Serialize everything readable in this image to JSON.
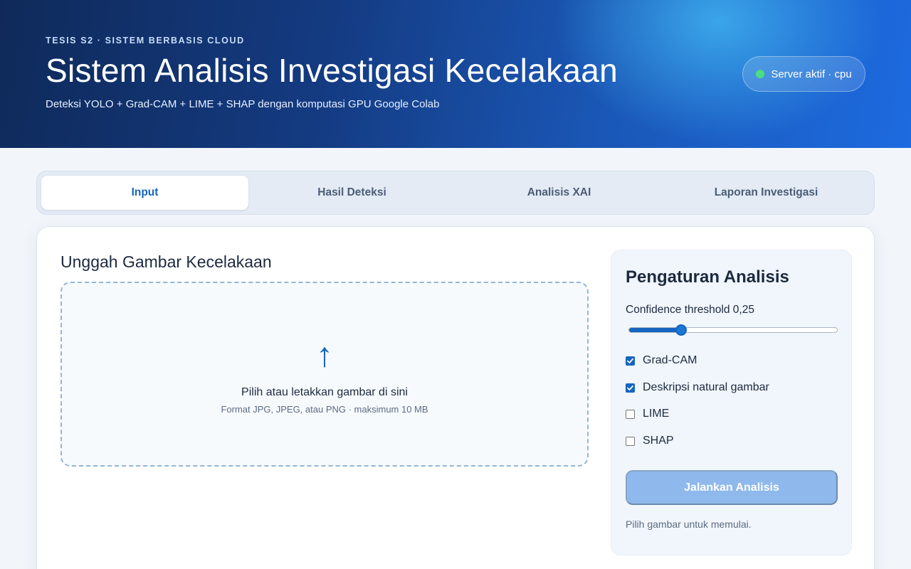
{
  "header": {
    "eyebrow": "TESIS S2 · SISTEM BERBASIS CLOUD",
    "title": "Sistem Analisis Investigasi Kecelakaan",
    "subtitle": "Deteksi YOLO + Grad-CAM + LIME + SHAP dengan komputasi GPU Google Colab",
    "server_status": "Server aktif · cpu"
  },
  "tabs": [
    {
      "label": "Input",
      "active": true
    },
    {
      "label": "Hasil Deteksi",
      "active": false
    },
    {
      "label": "Analisis XAI",
      "active": false
    },
    {
      "label": "Laporan Investigasi",
      "active": false
    }
  ],
  "upload": {
    "title": "Unggah Gambar Kecelakaan",
    "icon": "upload-arrow-icon",
    "icon_glyph": "↑",
    "main_text": "Pilih atau letakkan gambar di sini",
    "sub_text": "Format JPG, JPEG, atau PNG · maksimum 10 MB"
  },
  "settings": {
    "title": "Pengaturan Analisis",
    "threshold_label": "Confidence threshold 0,25",
    "threshold_value": 0.25,
    "options": [
      {
        "label": "Grad-CAM",
        "checked": true
      },
      {
        "label": "Deskripsi natural gambar",
        "checked": true
      },
      {
        "label": "LIME",
        "checked": false
      },
      {
        "label": "SHAP",
        "checked": false
      }
    ],
    "run_button": "Jalankan Analisis",
    "hint": "Pilih gambar untuk memulai."
  },
  "colors": {
    "accent": "#1565c0",
    "status_online": "#4ade80",
    "button_disabled": "#8fb8ec"
  }
}
